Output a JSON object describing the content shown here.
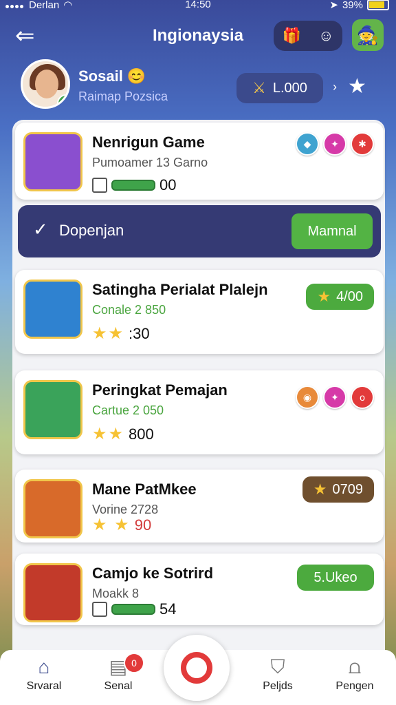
{
  "status": {
    "carrier": "Derlan",
    "time": "14:50",
    "battery": "39%"
  },
  "header": {
    "title": "Ingionaysia",
    "icons": [
      "gift-icon",
      "face-icon"
    ]
  },
  "profile": {
    "name": "Sosail 😊",
    "subtitle": "Raimap Pozsica",
    "coins": "L.000"
  },
  "cards": [
    {
      "title": "Nenrigun Game",
      "subtitle": "Pumoamer 13 Garno",
      "meta": "00",
      "accent": "#8a4fcf"
    },
    {
      "title": "Satingha Perialat Plalejn",
      "subtitle": "Conale 2 850",
      "meta": ":30",
      "badge": "4/00",
      "accent": "#2f82d0"
    },
    {
      "title": "Peringkat Pemajan",
      "subtitle": "Cartue 2 050",
      "meta": "800",
      "accent": "#3aa35a"
    },
    {
      "title": "Mane PatMkee",
      "subtitle": "Vorine 2728",
      "meta": "90",
      "badge": "0709",
      "accent": "#d86a2a"
    },
    {
      "title": "Camjo ke Sotrird",
      "subtitle": "Moakk 8",
      "meta": "54",
      "badge": "5.Ukeo",
      "accent": "#c23a2a"
    }
  ],
  "section": {
    "label": "Dopenjan",
    "button": "Mamnal"
  },
  "nav": [
    "Srvaral",
    "Senal",
    "",
    "Peljds",
    "Pengen"
  ],
  "nav_badge": "0",
  "colors": {
    "navy": "#353a74",
    "green": "#53b344",
    "gold": "#f6c234",
    "red": "#e23a3a"
  }
}
